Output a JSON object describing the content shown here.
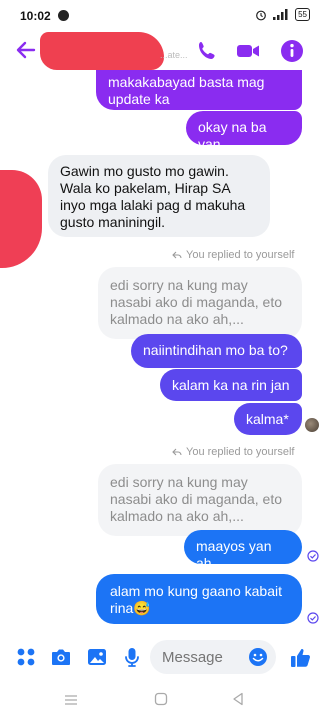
{
  "status": {
    "time": "10:02",
    "battery": "55"
  },
  "header": {
    "contact_name_partial": "...ate..."
  },
  "messages": [
    {
      "id": "m1",
      "text": "makakabayad basta mag update ka"
    },
    {
      "id": "m2",
      "text": "okay na ba yan"
    },
    {
      "id": "m3",
      "text": "Gawin mo gusto mo gawin. Wala ko pakelam, Hirap SA inyo mga lalaki pag d makuha gusto maniningil."
    },
    {
      "id": "m4",
      "text": "edi sorry na kung may nasabi ako di maganda,  eto kalmado na ako ah,..."
    },
    {
      "id": "m5",
      "text": "naiintindihan mo ba to?"
    },
    {
      "id": "m6",
      "text": "kalam ka na rin jan"
    },
    {
      "id": "m7",
      "text": "kalma*"
    },
    {
      "id": "m8",
      "text": "edi sorry na kung may nasabi ako di maganda,  eto kalmado na ako ah,..."
    },
    {
      "id": "m9",
      "text": "maayos yan ah"
    },
    {
      "id": "m10",
      "text": "alam mo kung gaano kabait rina😅"
    }
  ],
  "reply_notes": [
    {
      "text": "You replied to yourself"
    },
    {
      "text": "You replied to yourself"
    }
  ],
  "composer": {
    "placeholder": "Message"
  },
  "colors": {
    "accent": "#8a2cf0",
    "blue": "#1c74f5",
    "name_redaction": "#ef4050"
  }
}
